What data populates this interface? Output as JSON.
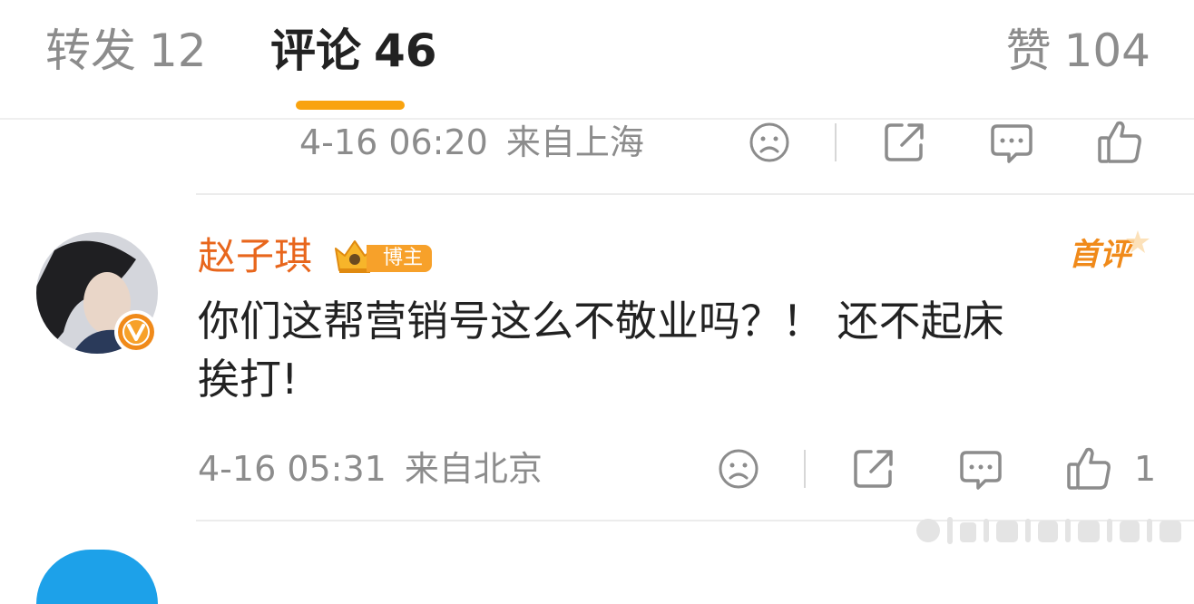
{
  "tabs": {
    "repost": {
      "label": "转发",
      "count": "12"
    },
    "comment": {
      "label": "评论",
      "count": "46"
    },
    "like": {
      "label": "赞",
      "count": "104"
    },
    "active": "comment",
    "accent_color": "#f9a30f"
  },
  "previous_comment": {
    "time": "4-16 06:20",
    "source": "来自上海"
  },
  "comment": {
    "username": "赵子琪",
    "badge_label": "博主",
    "first_badge": "首评",
    "text_line1": "你们这帮营销号这么不敬业吗？！ 还不起床",
    "text_line2": "挨打!",
    "time": "4-16 05:31",
    "source": "来自北京",
    "like_count": "1",
    "username_color": "#e8661c"
  },
  "icons": {
    "dislike": "sad-face-icon",
    "share": "share-icon",
    "reply": "comment-bubble-icon",
    "like": "thumbs-up-icon",
    "verified": "verified-v-icon"
  }
}
